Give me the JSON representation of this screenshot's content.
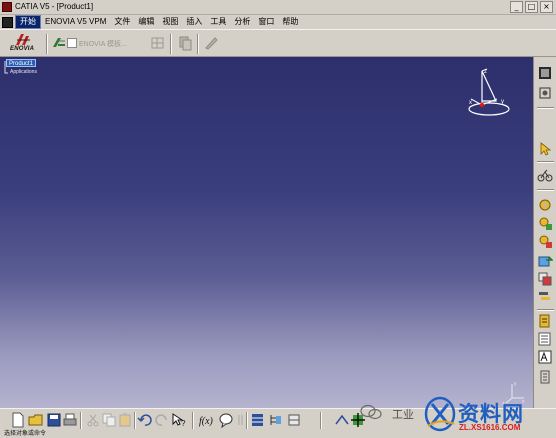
{
  "window": {
    "title": "CATIA V5 - [Product1]",
    "minimize_glyph": "_",
    "restore_glyph": "□",
    "close_glyph": "×"
  },
  "menu": {
    "items": [
      "开始",
      "ENOVIA V5 VPM",
      "文件",
      "编辑",
      "视图",
      "插入",
      "工具",
      "分析",
      "窗口",
      "帮助"
    ],
    "active_item": "开始"
  },
  "top_toolbar": {
    "brand_text": "ENOVIA",
    "disabled_label": "ENOVIA 模板...",
    "icons": [
      "enovia-logo-icon",
      "enovia-tool-icon",
      "checkbox-icon",
      "grid-tool-icon",
      "copy-tool-icon",
      "pen-tool-icon"
    ]
  },
  "spec_tree": {
    "root": "Product1",
    "child": "Applications"
  },
  "compass": {
    "axis_z": "z",
    "axis_x": "x",
    "axis_y": "y",
    "icon": "compass-icon"
  },
  "axis_indicator": {
    "axis_y": "y",
    "axis_x": "x",
    "axis_z": "z"
  },
  "right_toolbar": {
    "icons": [
      "film-icon",
      "fit-all-icon",
      "select-arrow-icon",
      "bike-icon",
      "product-icon",
      "component-icon",
      "part-icon",
      "existing-component-icon",
      "replace-icon",
      "graph-tree-icon",
      "generate-numbering-icon",
      "bill-of-material-icon",
      "text-edit-icon",
      "scroll-icon"
    ]
  },
  "bottom_toolbar": {
    "icons": [
      "new-file-icon",
      "open-folder-icon",
      "save-icon",
      "print-icon",
      "cut-icon",
      "copy-icon",
      "paste-icon",
      "undo-icon",
      "redo-icon",
      "help-arrow-icon",
      "formula-icon",
      "knowledge-icon",
      "catalog-icon",
      "tree-icon",
      "table-icon",
      "measure-icon",
      "fit-icon",
      "rotate-icon"
    ]
  },
  "status": {
    "text": "选择对象或命令"
  },
  "watermark": {
    "small_text": "工业",
    "chinese": "资料网",
    "url": "ZL.XS1616.COM",
    "icons": [
      "wechat-icon",
      "xs-logo-icon"
    ]
  },
  "colors": {
    "viewport_top": "#2c2f6b",
    "viewport_bottom": "#b5b3ce",
    "chrome": "#d4d0c8",
    "tree_highlight": "#2a5fb0",
    "watermark_blue": "#1f5fbf",
    "watermark_red": "#d62020"
  }
}
